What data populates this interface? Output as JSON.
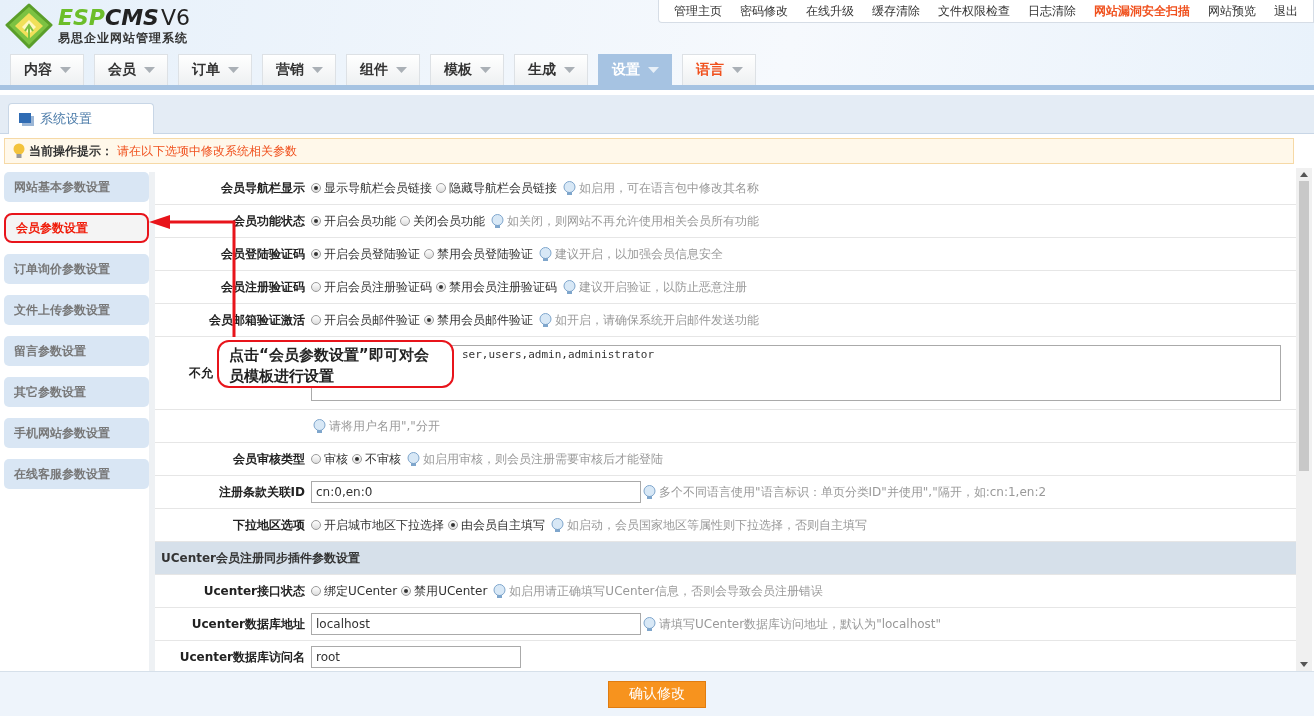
{
  "logo": {
    "brand_a": "ESP",
    "brand_b": "CMS",
    "version": "V6",
    "subtitle": "易思企业网站管理系统"
  },
  "top_links": [
    {
      "label": "管理主页",
      "kind": "normal"
    },
    {
      "label": "密码修改",
      "kind": "normal"
    },
    {
      "label": "在线升级",
      "kind": "normal"
    },
    {
      "label": "缓存清除",
      "kind": "normal"
    },
    {
      "label": "文件权限检查",
      "kind": "normal"
    },
    {
      "label": "日志清除",
      "kind": "normal"
    },
    {
      "label": "网站漏洞安全扫描",
      "kind": "alert"
    },
    {
      "label": "网站预览",
      "kind": "normal"
    },
    {
      "label": "退出",
      "kind": "normal"
    }
  ],
  "nav_tabs": [
    {
      "label": "内容",
      "selected": false,
      "kind": "normal"
    },
    {
      "label": "会员",
      "selected": false,
      "kind": "normal"
    },
    {
      "label": "订单",
      "selected": false,
      "kind": "normal"
    },
    {
      "label": "营销",
      "selected": false,
      "kind": "normal"
    },
    {
      "label": "组件",
      "selected": false,
      "kind": "normal"
    },
    {
      "label": "模板",
      "selected": false,
      "kind": "normal"
    },
    {
      "label": "生成",
      "selected": false,
      "kind": "normal"
    },
    {
      "label": "设置",
      "selected": true,
      "kind": "normal"
    },
    {
      "label": "语言",
      "selected": false,
      "kind": "accent"
    }
  ],
  "page_tab": {
    "label": "系统设置"
  },
  "tip": {
    "label": "当前操作提示：",
    "text": "请在以下选项中修改系统相关参数"
  },
  "sidebar": {
    "items": [
      {
        "label": "网站基本参数设置",
        "selected": false
      },
      {
        "label": "会员参数设置",
        "selected": true
      },
      {
        "label": "订单询价参数设置",
        "selected": false
      },
      {
        "label": "文件上传参数设置",
        "selected": false
      },
      {
        "label": "留言参数设置",
        "selected": false
      },
      {
        "label": "其它参数设置",
        "selected": false
      },
      {
        "label": "手机网站参数设置",
        "selected": false
      },
      {
        "label": "在线客服参数设置",
        "selected": false
      }
    ]
  },
  "form": {
    "rows": [
      {
        "kind": "radio",
        "label": "会员导航栏显示",
        "options": [
          {
            "label": "显示导航栏会员链接",
            "selected": true
          },
          {
            "label": "隐藏导航栏会员链接",
            "selected": false
          }
        ],
        "hint": "如启用，可在语言包中修改其名称"
      },
      {
        "kind": "radio",
        "label": "会员功能状态",
        "options": [
          {
            "label": "开启会员功能",
            "selected": true
          },
          {
            "label": "关闭会员功能",
            "selected": false
          }
        ],
        "hint": "如关闭，则网站不再允许使用相关会员所有功能"
      },
      {
        "kind": "radio",
        "label": "会员登陆验证码",
        "options": [
          {
            "label": "开启会员登陆验证",
            "selected": true
          },
          {
            "label": "禁用会员登陆验证",
            "selected": false
          }
        ],
        "hint": "建议开启，以加强会员信息安全"
      },
      {
        "kind": "radio",
        "label": "会员注册验证码",
        "options": [
          {
            "label": "开启会员注册验证码",
            "selected": false
          },
          {
            "label": "禁用会员注册验证码",
            "selected": true
          }
        ],
        "hint": "建议开启验证，以防止恶意注册"
      },
      {
        "kind": "radio",
        "label": "会员邮箱验证激活",
        "options": [
          {
            "label": "开启会员邮件验证",
            "selected": false
          },
          {
            "label": "禁用会员邮件验证",
            "selected": true
          }
        ],
        "hint": "如开启，请确保系统开启邮件发送功能"
      },
      {
        "kind": "textarea",
        "label": "不允",
        "value": "ser,users,admin,administrator"
      },
      {
        "kind": "hint",
        "hint": "请将用户名用\",\"分开"
      },
      {
        "kind": "radio",
        "label": "会员审核类型",
        "options": [
          {
            "label": "审核",
            "selected": false
          },
          {
            "label": "不审核",
            "selected": true
          }
        ],
        "hint": "如启用审核，则会员注册需要审核后才能登陆"
      },
      {
        "kind": "text",
        "label": "注册条款关联ID",
        "value": "cn:0,en:0",
        "hint": "多个不同语言使用\"语言标识：单页分类ID\"并使用\",\"隔开，如:cn:1,en:2"
      },
      {
        "kind": "radio",
        "label": "下拉地区选项",
        "options": [
          {
            "label": "开启城市地区下拉选择",
            "selected": false
          },
          {
            "label": "由会员自主填写",
            "selected": true
          }
        ],
        "hint": "如启动，会员国家地区等属性则下拉选择，否则自主填写"
      },
      {
        "kind": "section",
        "label": "UCenter会员注册同步插件参数设置"
      },
      {
        "kind": "radio",
        "label": "Ucenter接口状态",
        "options": [
          {
            "label": "绑定UCenter",
            "selected": false
          },
          {
            "label": "禁用UCenter",
            "selected": true
          }
        ],
        "hint": "如启用请正确填写UCenter信息，否则会导致会员注册错误"
      },
      {
        "kind": "text",
        "label": "Ucenter数据库地址",
        "value": "localhost",
        "hint": "请填写UCenter数据库访问地址，默认为\"localhost\""
      },
      {
        "kind": "text",
        "label": "Ucenter数据库访问名",
        "value": "root",
        "short": true
      }
    ]
  },
  "callout": {
    "text": "点击“会员参数设置”即可对会员模板进行设置"
  },
  "submit": {
    "label": "确认修改"
  }
}
